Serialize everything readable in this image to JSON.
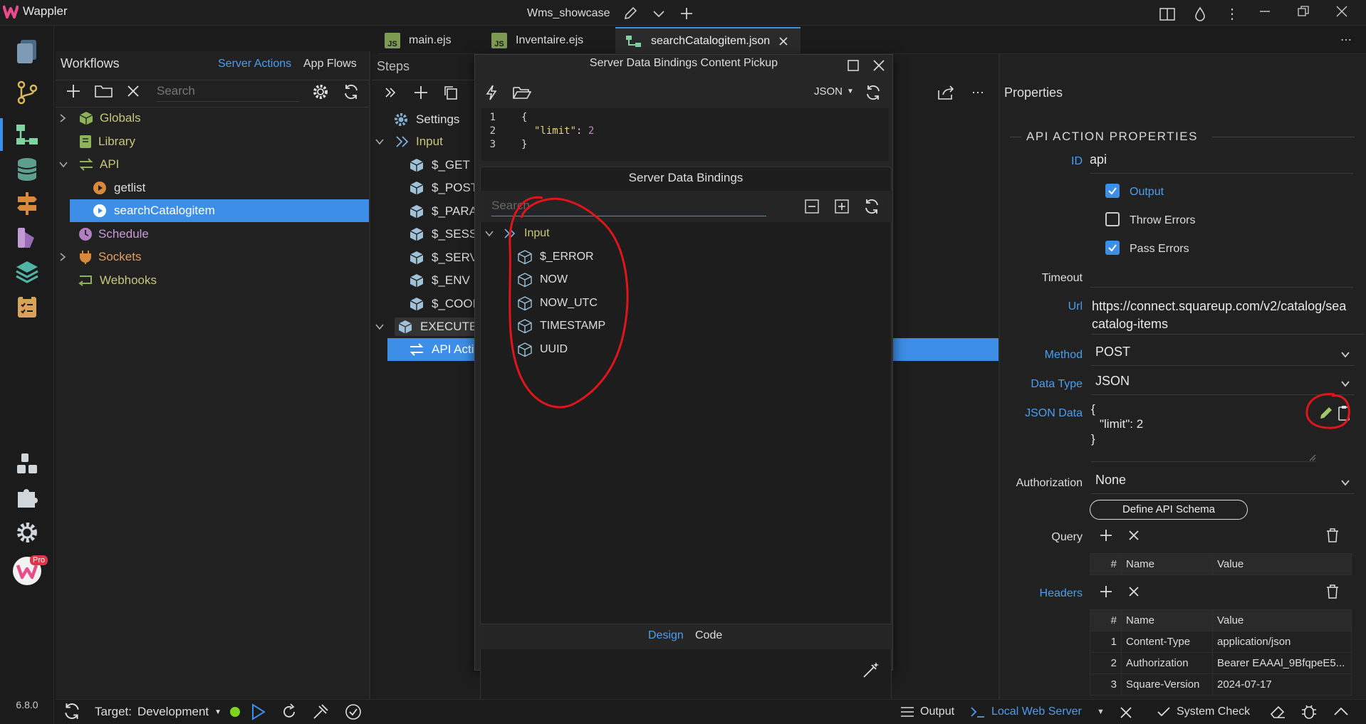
{
  "app": {
    "name": "Wappler",
    "project": "Wms_showcase",
    "version": "6.8.0",
    "pro_badge": "Pro"
  },
  "tabs": [
    {
      "label": "main.ejs",
      "badge": "JS"
    },
    {
      "label": "Inventaire.ejs",
      "badge": "JS"
    },
    {
      "label": "searchCatalogitem.json",
      "active": true
    }
  ],
  "workflows": {
    "title": "Workflows",
    "tab_server": "Server Actions",
    "tab_app": "App Flows",
    "search_placeholder": "Search",
    "tree": [
      {
        "label": "Globals"
      },
      {
        "label": "Library"
      },
      {
        "label": "API"
      },
      {
        "label": "getlist"
      },
      {
        "label": "searchCatalogitem",
        "selected": true
      },
      {
        "label": "Schedule"
      },
      {
        "label": "Sockets"
      },
      {
        "label": "Webhooks"
      }
    ]
  },
  "steps": {
    "title": "Steps",
    "items": [
      {
        "label": "Settings"
      },
      {
        "label": "Input"
      },
      {
        "label": "$_GET"
      },
      {
        "label": "$_POST"
      },
      {
        "label": "$_PARAM"
      },
      {
        "label": "$_SESSIO"
      },
      {
        "label": "$_SERVE"
      },
      {
        "label": "$_ENV"
      },
      {
        "label": "$_COOKI"
      },
      {
        "label": "EXECUTE"
      },
      {
        "label": "API Actio"
      }
    ]
  },
  "pickup": {
    "title": "Server Data Bindings Content Pickup",
    "format": "JSON",
    "code": [
      {
        "num": "1",
        "text": "{"
      },
      {
        "num": "2",
        "key": "\"limit\"",
        "colon": ": ",
        "value": "2"
      },
      {
        "num": "3",
        "text": "}"
      }
    ]
  },
  "bindings": {
    "title": "Server Data Bindings",
    "search_placeholder": "Search",
    "root": "Input",
    "items": [
      "$_ERROR",
      "NOW",
      "NOW_UTC",
      "TIMESTAMP",
      "UUID"
    ],
    "tab_design": "Design",
    "tab_code": "Code"
  },
  "properties": {
    "title": "Properties",
    "section": "API ACTION PROPERTIES",
    "id_label": "ID",
    "id_value": "api",
    "output_label": "Output",
    "throw_errors_label": "Throw Errors",
    "pass_errors_label": "Pass Errors",
    "output_checked": true,
    "throw_errors_checked": false,
    "pass_errors_checked": true,
    "timeout_label": "Timeout",
    "url_label": "Url",
    "url_line1": "https://connect.squareup.com/v2/catalog/sea",
    "url_line2": "catalog-items",
    "method_label": "Method",
    "method_value": "POST",
    "datatype_label": "Data Type",
    "datatype_value": "JSON",
    "jsondata_label": "JSON Data",
    "json_l1": "{",
    "json_l2": "\"limit\": 2",
    "json_l3": "}",
    "auth_label": "Authorization",
    "auth_value": "None",
    "define_schema": "Define API Schema",
    "query_label": "Query",
    "headers_label": "Headers",
    "col_num": "#",
    "col_name": "Name",
    "col_value": "Value",
    "headers": [
      {
        "n": "1",
        "name": "Content-Type",
        "value": "application/json"
      },
      {
        "n": "2",
        "name": "Authorization",
        "value": "Bearer EAAAl_9BfqpeE5..."
      },
      {
        "n": "3",
        "name": "Square-Version",
        "value": "2024-07-17"
      }
    ]
  },
  "statusbar": {
    "target_label": "Target:",
    "target_value": "Development",
    "output": "Output",
    "server": "Local Web Server",
    "system_check": "System Check"
  },
  "colors": {
    "accent": "#3b8fe8",
    "selected": "#3d8ee6",
    "annotation": "#e0151b",
    "green": "#9fc96a"
  }
}
